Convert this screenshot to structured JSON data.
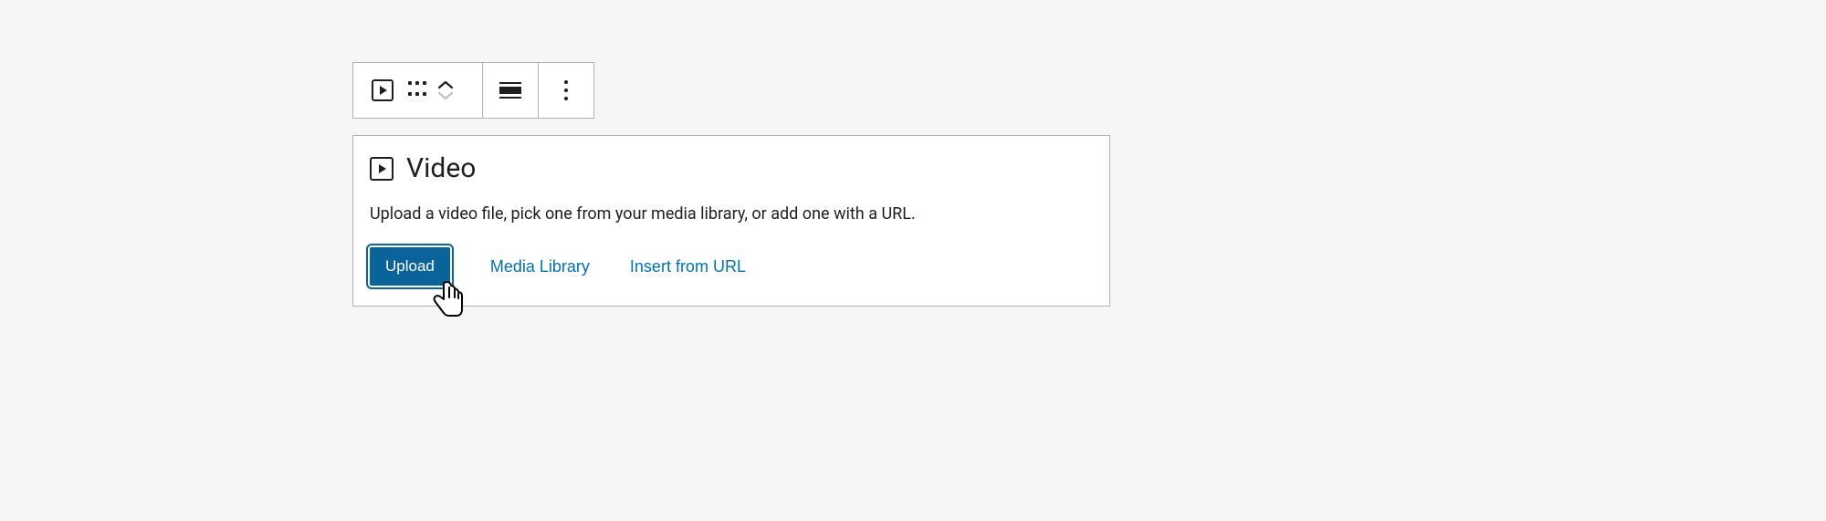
{
  "toolbar": {
    "block_type_label": "Video block",
    "drag_label": "Drag",
    "move_up_label": "Move up",
    "move_down_label": "Move down",
    "align_label": "Change alignment",
    "more_label": "Options"
  },
  "placeholder": {
    "title": "Video",
    "description": "Upload a video file, pick one from your media library, or add one with a URL.",
    "actions": {
      "upload": "Upload",
      "media_library": "Media Library",
      "insert_from_url": "Insert from URL"
    }
  },
  "colors": {
    "primary": "#0a6399",
    "link": "#0073aa"
  }
}
